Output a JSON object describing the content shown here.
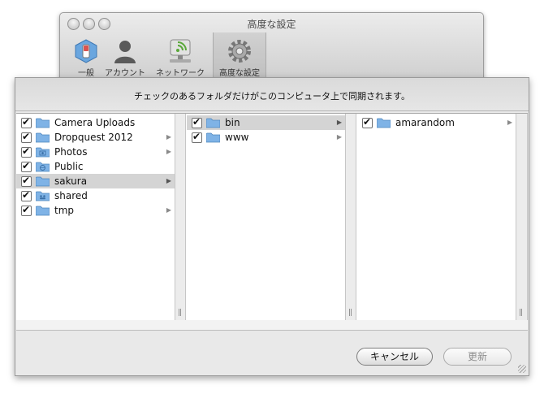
{
  "prefs_window": {
    "title": "高度な設定",
    "toolbar": [
      {
        "label": "一般",
        "icon": "switch-icon"
      },
      {
        "label": "アカウント",
        "icon": "person-icon"
      },
      {
        "label": "ネットワーク",
        "icon": "network-icon"
      },
      {
        "label": "高度な設定",
        "icon": "gear-icon",
        "selected": true
      }
    ]
  },
  "sheet": {
    "instruction": "チェックのあるフォルダだけがこのコンピュータ上で同期されます。",
    "columns": [
      {
        "items": [
          {
            "name": "Camera Uploads",
            "checked": true,
            "icon": "folder-icon",
            "has_children": false
          },
          {
            "name": "Dropquest 2012",
            "checked": true,
            "icon": "folder-icon",
            "has_children": true
          },
          {
            "name": "Photos",
            "checked": true,
            "icon": "photos-folder-icon",
            "has_children": true
          },
          {
            "name": "Public",
            "checked": true,
            "icon": "public-folder-icon",
            "has_children": false
          },
          {
            "name": "sakura",
            "checked": true,
            "icon": "folder-icon",
            "has_children": true,
            "selected": true
          },
          {
            "name": "shared",
            "checked": true,
            "icon": "shared-folder-icon",
            "has_children": false
          },
          {
            "name": "tmp",
            "checked": true,
            "icon": "folder-icon",
            "has_children": true
          }
        ]
      },
      {
        "items": [
          {
            "name": "bin",
            "checked": true,
            "icon": "folder-icon",
            "has_children": true,
            "selected": true
          },
          {
            "name": "www",
            "checked": true,
            "icon": "folder-icon",
            "has_children": true
          }
        ]
      },
      {
        "items": [
          {
            "name": "amarandom",
            "checked": true,
            "icon": "folder-icon",
            "has_children": true
          }
        ]
      }
    ],
    "cancel_label": "キャンセル",
    "update_label": "更新"
  },
  "colors": {
    "folder_blue": "#7fb3e6",
    "selection_gray": "#d4d4d4"
  }
}
